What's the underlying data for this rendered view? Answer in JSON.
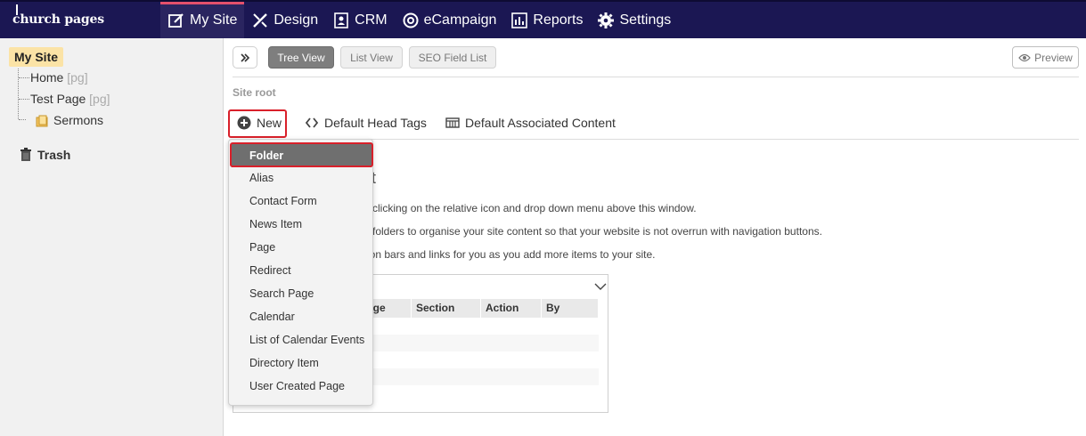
{
  "brand": {
    "logo_text": "church pages"
  },
  "nav": {
    "items": [
      {
        "label": "My Site",
        "icon": "edit-icon"
      },
      {
        "label": "Design",
        "icon": "design-icon"
      },
      {
        "label": "CRM",
        "icon": "crm-icon"
      },
      {
        "label": "eCampaign",
        "icon": "at-icon"
      },
      {
        "label": "Reports",
        "icon": "reports-icon"
      },
      {
        "label": "Settings",
        "icon": "gear-icon"
      }
    ],
    "active": "My Site"
  },
  "sidebar": {
    "root_label": "My Site",
    "items": [
      {
        "label": "Home",
        "tag": "[pg]"
      },
      {
        "label": "Test Page",
        "tag": "[pg]"
      },
      {
        "label": "Sermons",
        "tag": ""
      }
    ],
    "trash_label": "Trash"
  },
  "toolbar": {
    "views": [
      "Tree View",
      "List View",
      "SEO Field List"
    ],
    "active_view": "Tree View",
    "preview_label": "Preview"
  },
  "breadcrumb": {
    "label": "Site root"
  },
  "actions": {
    "new_label": "New",
    "head_tags_label": "Default Head Tags",
    "associated_label": "Default Associated Content"
  },
  "background": {
    "heading": "nt",
    "lines": [
      "by clicking on the relative icon and drop down menu above this window.",
      "se folders to organise your site content so that your website is not overrun with navigation buttons.",
      "ation bars and links for you as you add more items to your site."
    ],
    "table_headers": [
      "age",
      "Section",
      "Action",
      "By"
    ]
  },
  "new_menu": {
    "items": [
      "Folder",
      "Alias",
      "Contact Form",
      "News Item",
      "Page",
      "Redirect",
      "Search Page",
      "Calendar",
      "List of Calendar Events",
      "Directory Item",
      "User Created Page"
    ],
    "highlighted": "Folder"
  },
  "colors": {
    "nav_bg": "#1b1753",
    "nav_active_accent": "#e4506c",
    "highlight_red": "#d9202a",
    "sidebar_selected": "#fbe3a6"
  }
}
